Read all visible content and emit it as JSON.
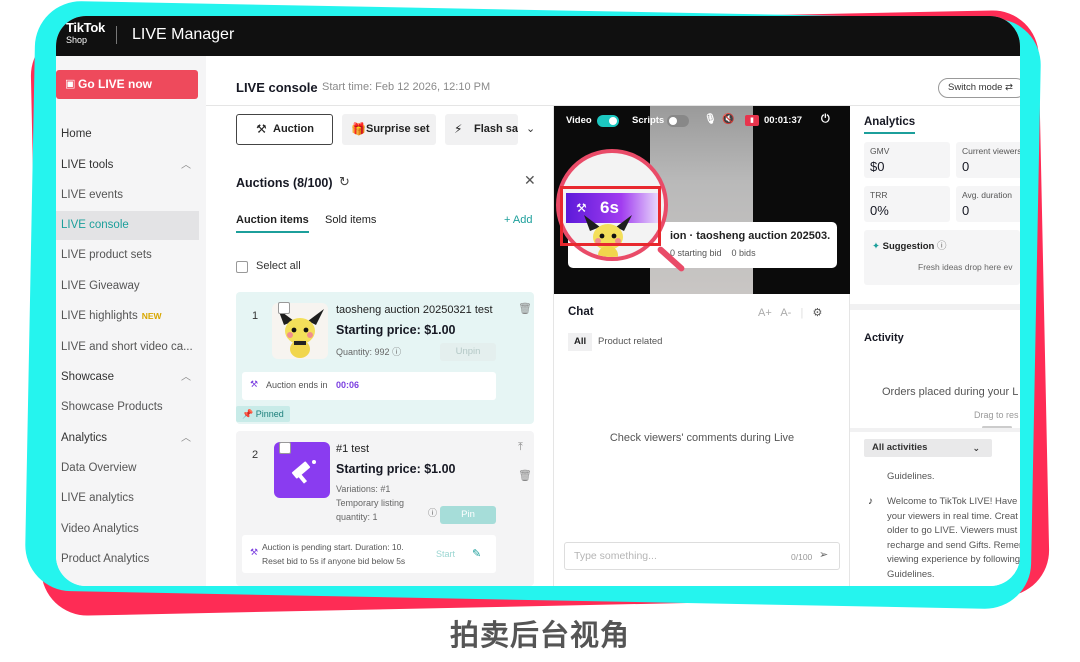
{
  "app": {
    "logo_main": "TikTok",
    "logo_sub": "Shop",
    "title": "LIVE Manager"
  },
  "sidebar": {
    "go_live_label": "Go LIVE now",
    "items": [
      {
        "label": "Home"
      },
      {
        "label": "LIVE tools"
      },
      {
        "label": "LIVE events"
      },
      {
        "label": "LIVE console"
      },
      {
        "label": "LIVE product sets"
      },
      {
        "label": "LIVE Giveaway"
      },
      {
        "label": "LIVE highlights",
        "badge": "NEW"
      },
      {
        "label": "LIVE and short video ca..."
      },
      {
        "label": "Showcase"
      },
      {
        "label": "Showcase Products"
      },
      {
        "label": "Analytics"
      },
      {
        "label": "Data Overview"
      },
      {
        "label": "LIVE analytics"
      },
      {
        "label": "Video Analytics"
      },
      {
        "label": "Product Analytics"
      }
    ]
  },
  "console": {
    "title": "LIVE console",
    "start_time": "Start time: Feb 12 2026, 12:10 PM",
    "switch_mode_label": "Switch mode"
  },
  "tools": {
    "auction": "Auction",
    "surprise_set": "Surprise set",
    "flash_sale": "Flash sal"
  },
  "auctions": {
    "heading": "Auctions (8/100)",
    "tab_items": "Auction items",
    "tab_sold": "Sold items",
    "add_label": "+ Add",
    "select_all": "Select all",
    "items": [
      {
        "index": "1",
        "title": "taosheng auction 20250321 test",
        "price": "Starting price: $1.00",
        "quantity": "Quantity: 992",
        "action": "Unpin",
        "status_prefix": "Auction ends in",
        "status_time": "00:06",
        "tag": "Pinned"
      },
      {
        "index": "2",
        "title": "#1 test",
        "price": "Starting price: $1.00",
        "variations": "Variations: #1",
        "temp_listing": "Temporary listing",
        "quantity": "quantity: 1",
        "action": "Pin",
        "status_line1": "Auction is pending start. Duration: 10.",
        "status_line2": "Reset bid to 5s if anyone bid below 5s",
        "start_label": "Start"
      }
    ]
  },
  "video": {
    "video_label": "Video",
    "scripts_label": "Scripts",
    "timer": "00:01:37",
    "countdown": "6s",
    "product_title": "ion · taosheng auction 202503...",
    "product_bid": "0 starting bid",
    "product_bids": "0 bids"
  },
  "chat": {
    "title": "Chat",
    "font_up": "A+",
    "font_down": "A-",
    "tab_all": "All",
    "tab_product": "Product related",
    "empty_text": "Check viewers' comments during Live",
    "input_placeholder": "Type something...",
    "counter": "0/100"
  },
  "analytics": {
    "title": "Analytics",
    "metrics": [
      {
        "label": "GMV",
        "value": "$0"
      },
      {
        "label": "Current viewers",
        "value": "0"
      },
      {
        "label": "TRR",
        "value": "0%"
      },
      {
        "label": "Avg. duration",
        "value": "0"
      }
    ],
    "suggestion_title": "Suggestion",
    "suggestion_body": "Fresh ideas drop here ev",
    "activity_title": "Activity",
    "orders_text": "Orders placed during your L",
    "drag_text": "Drag to res",
    "filter_label": "All activities",
    "activity_lines": [
      "Guidelines.",
      "Welcome to TikTok LIVE! Have f",
      "your viewers in real time. Creat",
      "older to go LIVE. Viewers must b",
      "recharge and send Gifts. Remen",
      "viewing experience by following",
      "Guidelines."
    ]
  },
  "caption": "拍卖后台视角",
  "colors": {
    "accent": "#1c9f9b",
    "go_live": "#ee4a5c",
    "frame_red": "#fe2c55",
    "frame_cyan": "#25f4ee",
    "countdown_purple": "#7a2ae6"
  },
  "icons": [
    "gavel-icon",
    "gift-icon",
    "flash-icon",
    "refresh-icon",
    "close-icon",
    "pin-icon",
    "trash-icon",
    "edit-icon",
    "mic-icon",
    "mute-icon",
    "power-icon",
    "settings-icon",
    "send-icon",
    "sparkle-icon",
    "help-icon",
    "tiktok-icon"
  ]
}
